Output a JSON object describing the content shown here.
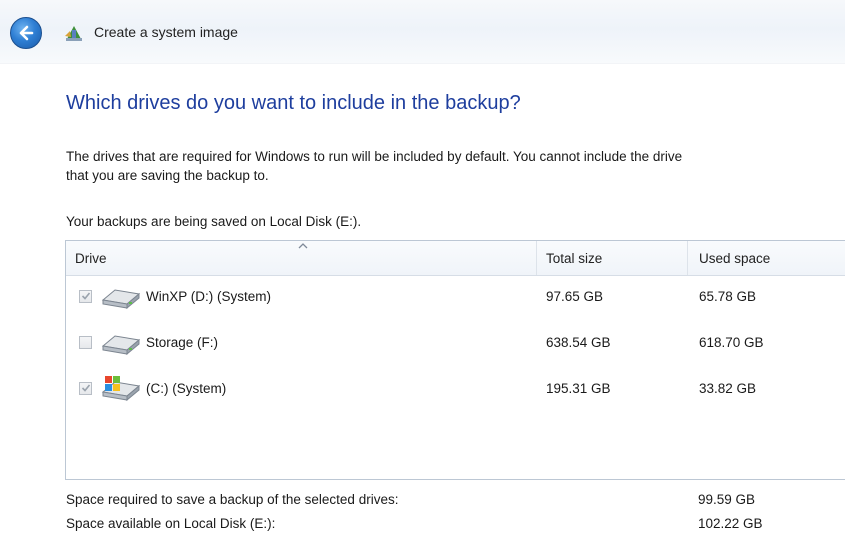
{
  "window": {
    "title": "Create a system image"
  },
  "page": {
    "heading": "Which drives do you want to include in the backup?",
    "description_line1": "The drives that are required for Windows to run will be included by default. You cannot include the drive",
    "description_line2": "that you are saving the backup to.",
    "saving_location": "Your backups are being saved on Local Disk (E:)."
  },
  "table": {
    "headers": {
      "drive": "Drive",
      "total_size": "Total size",
      "used_space": "Used space"
    },
    "rows": [
      {
        "name": "WinXP (D:) (System)",
        "total": "97.65 GB",
        "used": "65.78 GB",
        "checked": true,
        "disabled": true,
        "icon": "hard-drive-icon"
      },
      {
        "name": "Storage (F:)",
        "total": "638.54 GB",
        "used": "618.70 GB",
        "checked": false,
        "disabled": false,
        "icon": "hard-drive-icon"
      },
      {
        "name": "(C:) (System)",
        "total": "195.31 GB",
        "used": "33.82 GB",
        "checked": true,
        "disabled": true,
        "icon": "windows-drive-icon"
      }
    ]
  },
  "summary": {
    "required_label": "Space required to save a backup of the selected drives:",
    "required_value": "99.59 GB",
    "available_label": "Space available on Local Disk (E:):",
    "available_value": "102.22 GB"
  },
  "colors": {
    "heading": "#1e3e9e",
    "back_button": "#2f7fd4"
  }
}
